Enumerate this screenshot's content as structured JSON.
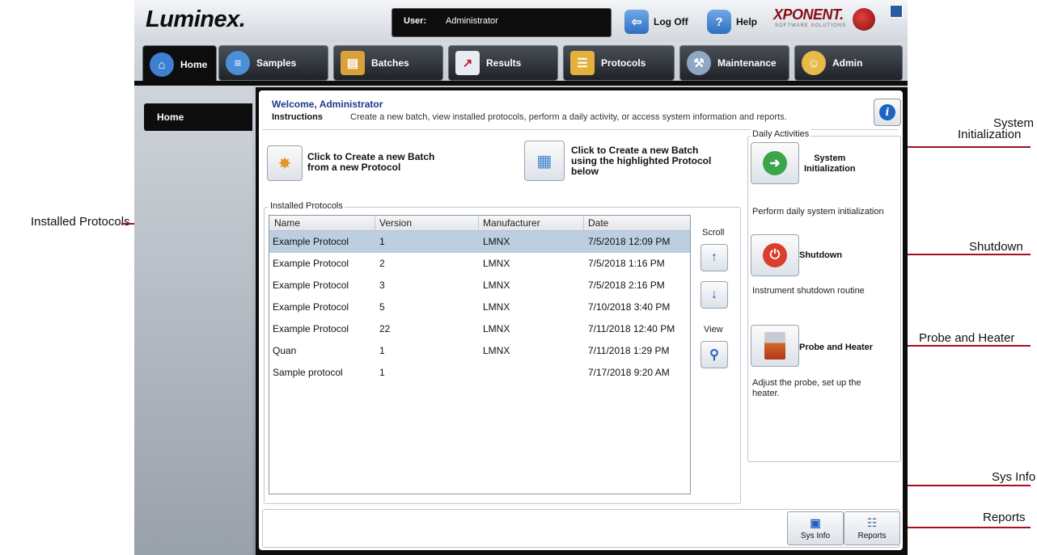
{
  "callouts": {
    "installed_protocols": "Installed Protocols",
    "system_initialization_line1": "System",
    "system_initialization_line2": "Initialization",
    "shutdown": "Shutdown",
    "probe_and_heater": "Probe and Heater",
    "sys_info": "Sys Info",
    "reports": "Reports"
  },
  "header": {
    "logo": "Luminex.",
    "user_label": "User:",
    "user_value": "Administrator",
    "logoff_label": "Log Off",
    "help_label": "Help",
    "brand": "XPONENT.",
    "brand_sub": "SOFTWARE SOLUTIONS"
  },
  "tabs": [
    {
      "label": "Home",
      "icon": "home-icon"
    },
    {
      "label": "Samples",
      "icon": "samples-icon"
    },
    {
      "label": "Batches",
      "icon": "batches-icon"
    },
    {
      "label": "Results",
      "icon": "results-icon"
    },
    {
      "label": "Protocols",
      "icon": "protocols-icon"
    },
    {
      "label": "Maintenance",
      "icon": "maintenance-icon"
    },
    {
      "label": "Admin",
      "icon": "admin-icon"
    }
  ],
  "sidebar": {
    "items": [
      {
        "label": "Home"
      }
    ]
  },
  "welcome": {
    "title": "Welcome, Administrator",
    "instructions_label": "Instructions",
    "instructions_text": "Create a new batch, view installed protocols, perform a daily activity, or access system information and reports."
  },
  "actions": {
    "new_batch_new_protocol": "Click to Create a new Batch from a new Protocol",
    "new_batch_line1": "Click to Create a new Batch",
    "new_batch_line2": "from a new Protocol",
    "highlighted_line1": "Click to Create a new Batch",
    "highlighted_line2": "using the highlighted Protocol",
    "highlighted_line3": "below"
  },
  "protocols": {
    "group_title": "Installed Protocols",
    "columns": [
      "Name",
      "Version",
      "Manufacturer",
      "Date"
    ],
    "rows": [
      {
        "name": "Example Protocol",
        "version": "1",
        "manufacturer": "LMNX",
        "date": "7/5/2018 12:09 PM"
      },
      {
        "name": "Example Protocol",
        "version": "2",
        "manufacturer": "LMNX",
        "date": "7/5/2018 1:16 PM"
      },
      {
        "name": "Example Protocol",
        "version": "3",
        "manufacturer": "LMNX",
        "date": "7/5/2018 2:16 PM"
      },
      {
        "name": "Example Protocol",
        "version": "5",
        "manufacturer": "LMNX",
        "date": "7/10/2018 3:40 PM"
      },
      {
        "name": "Example Protocol",
        "version": "22",
        "manufacturer": "LMNX",
        "date": "7/11/2018 12:40 PM"
      },
      {
        "name": "Quan",
        "version": "1",
        "manufacturer": "LMNX",
        "date": "7/11/2018 1:29 PM"
      },
      {
        "name": "Sample protocol",
        "version": "1",
        "manufacturer": "",
        "date": "7/17/2018 9:20 AM"
      }
    ],
    "scroll_label": "Scroll",
    "view_label": "View"
  },
  "daily": {
    "title": "Daily Activities",
    "sysinit_line1": "System",
    "sysinit_line2": "Initialization",
    "sysinit_desc": "Perform daily system initialization",
    "shutdown_label": "Shutdown",
    "shutdown_desc": "Instrument shutdown routine",
    "probe_label": "Probe and Heater",
    "probe_desc_line1": "Adjust the probe, set up the",
    "probe_desc_line2": "heater."
  },
  "bottom": {
    "sysinfo_label": "Sys Info",
    "reports_label": "Reports"
  },
  "colors": {
    "accent_red": "#a3121e",
    "selection": "#bccfe0",
    "header_blue": "#1d3a8a"
  }
}
